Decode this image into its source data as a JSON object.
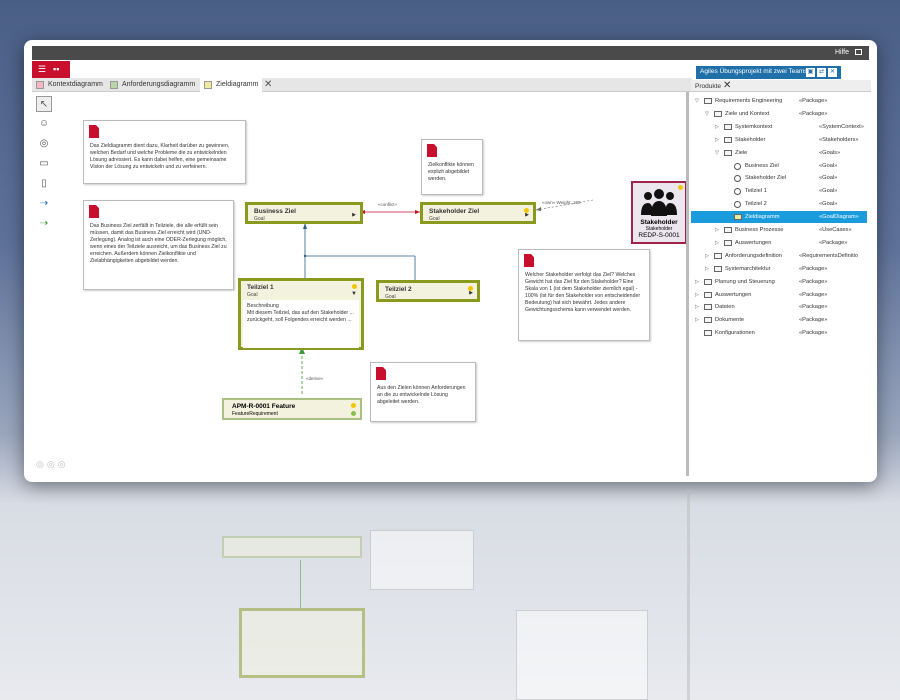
{
  "topbar": {
    "help": "Hilfe"
  },
  "tabs": [
    {
      "label": "Kontextdiagramm",
      "color": "#f4b6c2"
    },
    {
      "label": "Anforderungsdiagramm",
      "color": "#b9d7a6"
    },
    {
      "label": "Zieldiagramm",
      "color": "#f0e9a0"
    }
  ],
  "project": {
    "name": "Agiles Übungsprojekt mit zwei Teams"
  },
  "panel": {
    "title": "Produkte"
  },
  "tree": [
    {
      "name": "Requirements Engineering",
      "st": "«Package»",
      "lvl": 0,
      "icon": "folder",
      "tog": "▽"
    },
    {
      "name": "Ziele und Kontext",
      "st": "«Package»",
      "lvl": 1,
      "icon": "folder",
      "tog": "▽"
    },
    {
      "name": "Systemkontext",
      "st": "«SystemContext»",
      "lvl": 2,
      "icon": "folder",
      "tog": "▷"
    },
    {
      "name": "Stakeholder",
      "st": "«Stakeholders»",
      "lvl": 2,
      "icon": "folder",
      "tog": "▷"
    },
    {
      "name": "Ziele",
      "st": "«Goals»",
      "lvl": 2,
      "icon": "folder",
      "tog": "▽"
    },
    {
      "name": "Business Ziel",
      "st": "«Goal»",
      "lvl": 3,
      "icon": "goal",
      "tog": ""
    },
    {
      "name": "Stakeholder Ziel",
      "st": "«Goal»",
      "lvl": 3,
      "icon": "goal",
      "tog": ""
    },
    {
      "name": "Teilziel 1",
      "st": "«Goal»",
      "lvl": 3,
      "icon": "goal",
      "tog": ""
    },
    {
      "name": "Teilziel 2",
      "st": "«Goal»",
      "lvl": 3,
      "icon": "goal",
      "tog": ""
    },
    {
      "name": "Zieldiagramm",
      "st": "«GoalDiagram»",
      "lvl": 3,
      "icon": "diagram",
      "tog": "",
      "sel": true
    },
    {
      "name": "Business Prozesse",
      "st": "«UseCases»",
      "lvl": 2,
      "icon": "folder",
      "tog": "▷"
    },
    {
      "name": "Auswertungen",
      "st": "«Package»",
      "lvl": 2,
      "icon": "folder",
      "tog": "▷"
    },
    {
      "name": "Anforderungsdefinition",
      "st": "«RequirementsDefinitio",
      "lvl": 1,
      "icon": "folder",
      "tog": "▷"
    },
    {
      "name": "Systemarchitektur",
      "st": "«Package»",
      "lvl": 1,
      "icon": "folder",
      "tog": "▷"
    },
    {
      "name": "Planung und Steuerung",
      "st": "«Package»",
      "lvl": 0,
      "icon": "folder",
      "tog": "▷"
    },
    {
      "name": "Auswertungen",
      "st": "«Package»",
      "lvl": 0,
      "icon": "folder",
      "tog": "▷"
    },
    {
      "name": "Dateien",
      "st": "«Package»",
      "lvl": 0,
      "icon": "folder",
      "tog": "▷"
    },
    {
      "name": "Dokumente",
      "st": "«Package»",
      "lvl": 0,
      "icon": "folder",
      "tog": "▷"
    },
    {
      "name": "Konfigurationen",
      "st": "«Package»",
      "lvl": 0,
      "icon": "folder",
      "tog": ""
    }
  ],
  "notes": {
    "n1": "Das Zieldiagramm dient dazu, Klarheit darüber zu gewinnen, welchen Bedarf und welche Probleme die zu entwickelnden Lösung adressiert. Es kann dabei helfen, eine gemeinsame Vision der Lösung zu entwickeln und zu verfeinern.",
    "n2": "Das Business Ziel zerfällt in Teilziele, die alle erfüllt sein müssen, damit das Business Ziel erreicht wird (UND-Zerlegung). Analog ist auch eine ODER-Zerlegung möglich, wenn eines der Teilziele ausreicht, um das Business Ziel zu erreichen. Außerdem können Zielkonflikte und Zielabhängigkeiten abgebildet werden.",
    "n3": "Zielkonflikte können explizit abgebildet werden.",
    "n4": "Welcher Stakeholder verfolgt das Ziel? Welches Gewicht hat das Ziel für den Stakeholder? Eine Skala von 1 (ist dem Stakeholder ziemlich egal) - 100% (ist für den Stakeholder von entscheidender Bedeutung) hat sich bewährt. Jedes andere Gewichtungsschema kann verwendet werden.",
    "n5": "Aus den Zielen können Anforderungen an die zu entwickelnde Lösung abgeleitet werden."
  },
  "goals": {
    "business": {
      "title": "Business Ziel",
      "type": "Goal"
    },
    "stakeholder": {
      "title": "Stakeholder Ziel",
      "type": "Goal"
    },
    "t1": {
      "title": "Teilziel 1",
      "type": "Goal",
      "desc_label": "Beschreibung",
      "desc": "Mit diesem Teilziel, das auf den Stakeholder ... zurückgeht, soll Folgendes erreicht werden ..."
    },
    "t2": {
      "title": "Teilziel 2",
      "type": "Goal"
    }
  },
  "feature": {
    "title": "APM-R-0001   Feature",
    "type": "FeatureRequirement"
  },
  "stakeholder": {
    "name": "Stakeholder",
    "type": "Stakeholder",
    "id": "REDP-S-0001"
  },
  "labels": {
    "conflict": "«conflict»",
    "derive": "«derive»",
    "weight": "«own»  Weight: 100"
  }
}
